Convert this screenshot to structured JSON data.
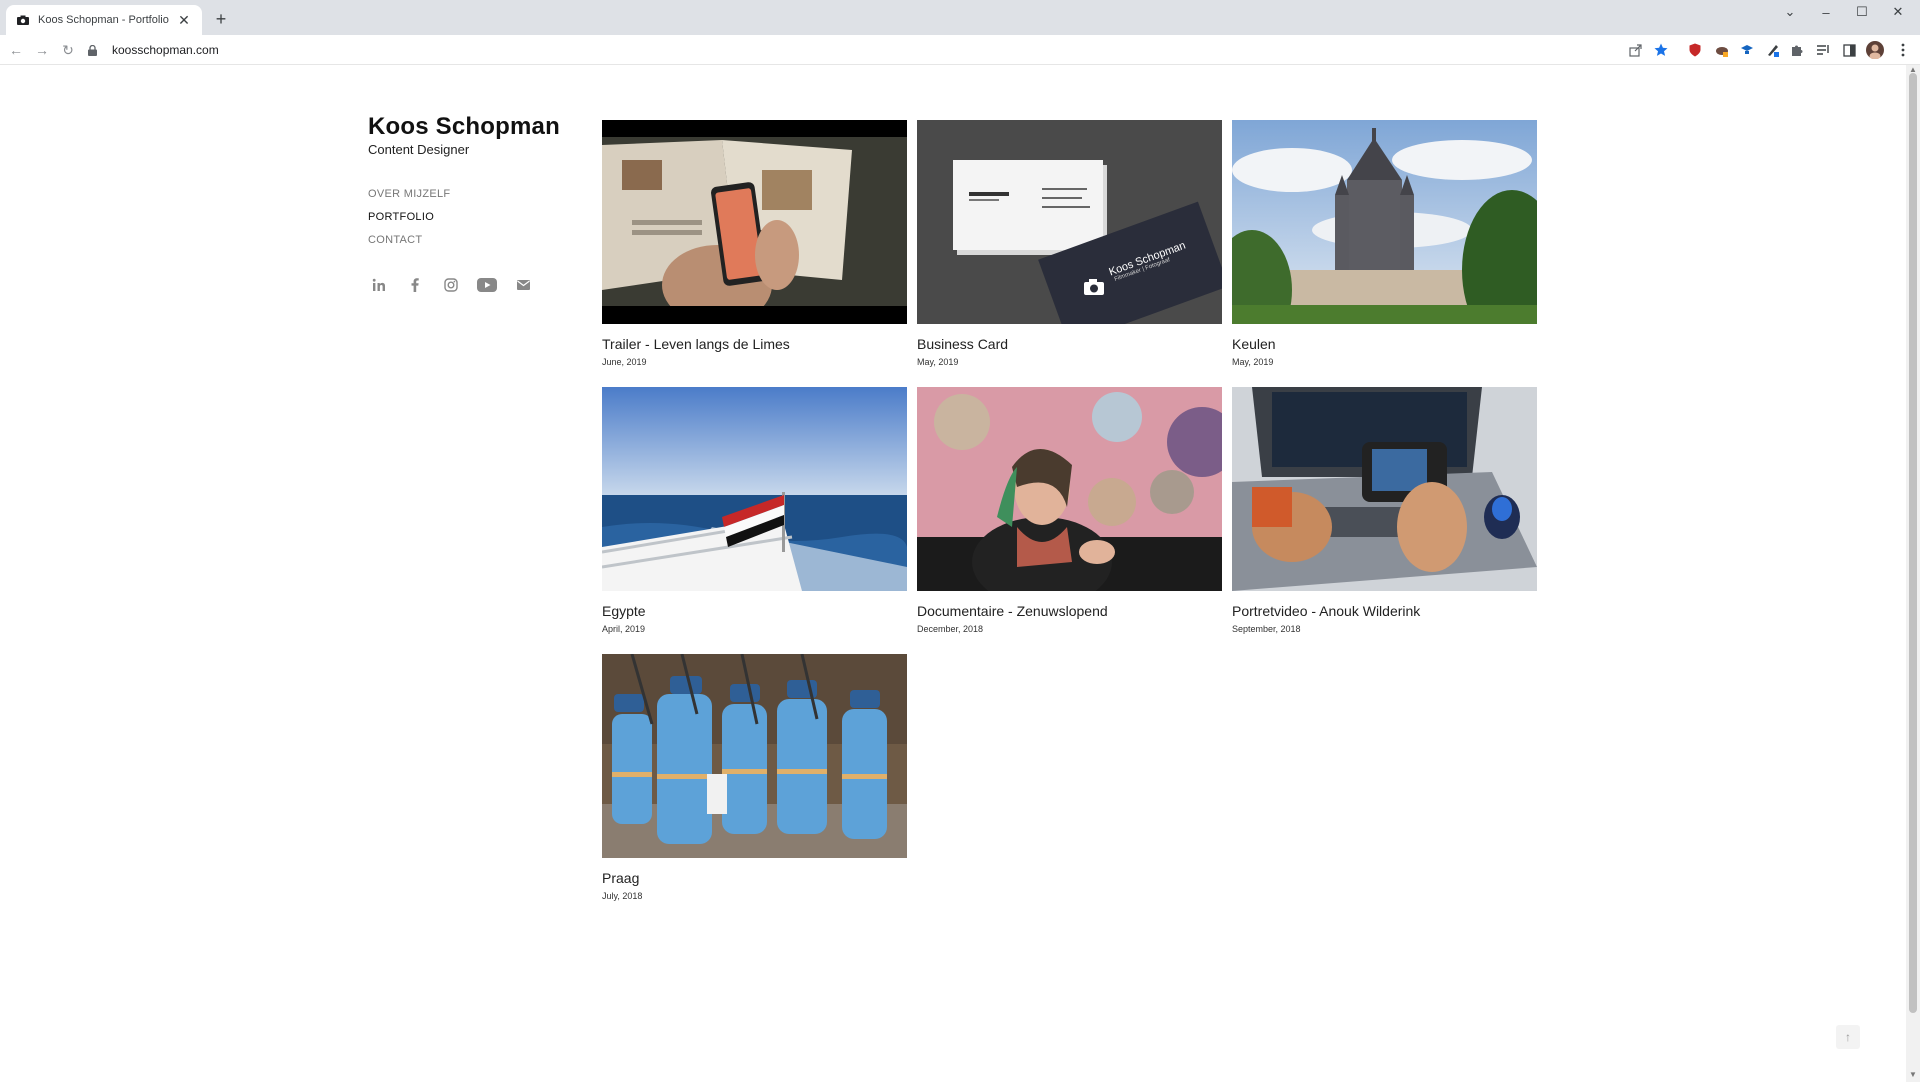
{
  "browser": {
    "tab_title": "Koos Schopman - Portfolio",
    "url": "koosschopman.com"
  },
  "site": {
    "name": "Koos Schopman",
    "role": "Content Designer",
    "menu": [
      {
        "label": "OVER MIJZELF",
        "active": false
      },
      {
        "label": "PORTFOLIO",
        "active": true
      },
      {
        "label": "CONTACT",
        "active": false
      }
    ],
    "socials": [
      "linkedin-icon",
      "facebook-icon",
      "instagram-icon",
      "youtube-icon",
      "mail-icon"
    ]
  },
  "portfolio": [
    {
      "title": "Trailer - Leven langs de Limes",
      "date": "June, 2019"
    },
    {
      "title": "Business Card",
      "date": "May, 2019"
    },
    {
      "title": "Keulen",
      "date": "May, 2019"
    },
    {
      "title": "Egypte",
      "date": "April, 2019"
    },
    {
      "title": "Documentaire - Zenuwslopend",
      "date": "December, 2018"
    },
    {
      "title": "Portretvideo - Anouk Wilderink",
      "date": "September, 2018"
    },
    {
      "title": "Praag",
      "date": "July, 2018"
    }
  ],
  "business_card": {
    "name": "Koos Schopman",
    "subtitle": "Filmmaker | Fotograaf"
  }
}
